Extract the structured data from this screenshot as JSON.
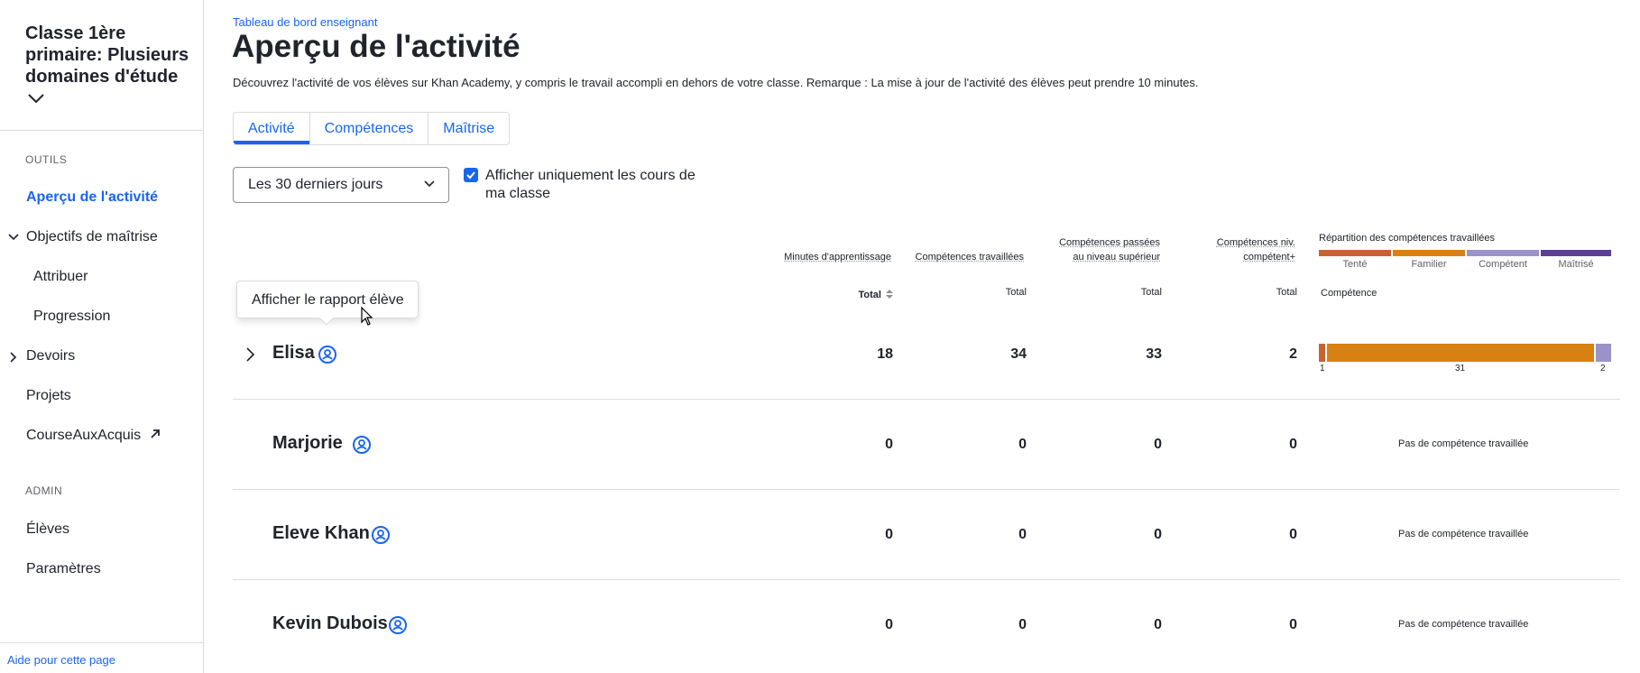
{
  "sidebar": {
    "class_title": "Classe 1ère primaire: Plusieurs domaines d'étude",
    "tools_label": "OUTILS",
    "admin_label": "ADMIN",
    "items": {
      "activity": "Aperçu de l'activité",
      "mastery_goals": "Objectifs de maîtrise",
      "assign": "Attribuer",
      "progress": "Progression",
      "assignments": "Devoirs",
      "projects": "Projets",
      "course": "CourseAuxAcquis",
      "students": "Élèves",
      "settings": "Paramètres"
    },
    "help": "Aide pour cette page"
  },
  "header": {
    "breadcrumb": "Tableau de bord enseignant",
    "title": "Aperçu de l'activité",
    "description": "Découvrez l'activité de vos élèves sur Khan Academy, y compris le travail accompli en dehors de votre classe. Remarque : La mise à jour de l'activité des élèves peut prendre 10 minutes."
  },
  "tabs": [
    "Activité",
    "Compétences",
    "Maîtrise"
  ],
  "filters": {
    "period": "Les 30 derniers jours",
    "checkbox_label": "Afficher uniquement les cours de ma classe",
    "checkbox_checked": true
  },
  "table": {
    "headers": {
      "minutes": "Minutes d'apprentissage",
      "worked": "Compétences travaillées",
      "leveled_up": "Compétences passées au niveau supérieur",
      "proficient": "Compétences niv. compétent+",
      "distribution": "Répartition des compétences travaillées"
    },
    "total_label": "Total",
    "competence_label": "Compétence",
    "legend": [
      {
        "label": "Tenté",
        "color": "#c8632e"
      },
      {
        "label": "Familier",
        "color": "#d98012"
      },
      {
        "label": "Compétent",
        "color": "#9b92c9"
      },
      {
        "label": "Maîtrisé",
        "color": "#5c3d99"
      }
    ],
    "no_skill_text": "Pas de compétence travaillée",
    "rows": [
      {
        "name": "Elisa",
        "minutes": "18",
        "worked": "34",
        "leveled_up": "33",
        "proficient": "2",
        "dist": {
          "attempted": "1",
          "familiar": "31",
          "proficient": "2"
        }
      },
      {
        "name": "Marjorie",
        "minutes": "0",
        "worked": "0",
        "leveled_up": "0",
        "proficient": "0"
      },
      {
        "name": "Eleve Khan",
        "minutes": "0",
        "worked": "0",
        "leveled_up": "0",
        "proficient": "0"
      },
      {
        "name": "Kevin Dubois",
        "minutes": "0",
        "worked": "0",
        "leveled_up": "0",
        "proficient": "0"
      }
    ]
  },
  "tooltip": "Afficher le rapport élève",
  "colors": {
    "accent": "#1865f2",
    "text": "#21242c",
    "border": "#dadbdd"
  }
}
